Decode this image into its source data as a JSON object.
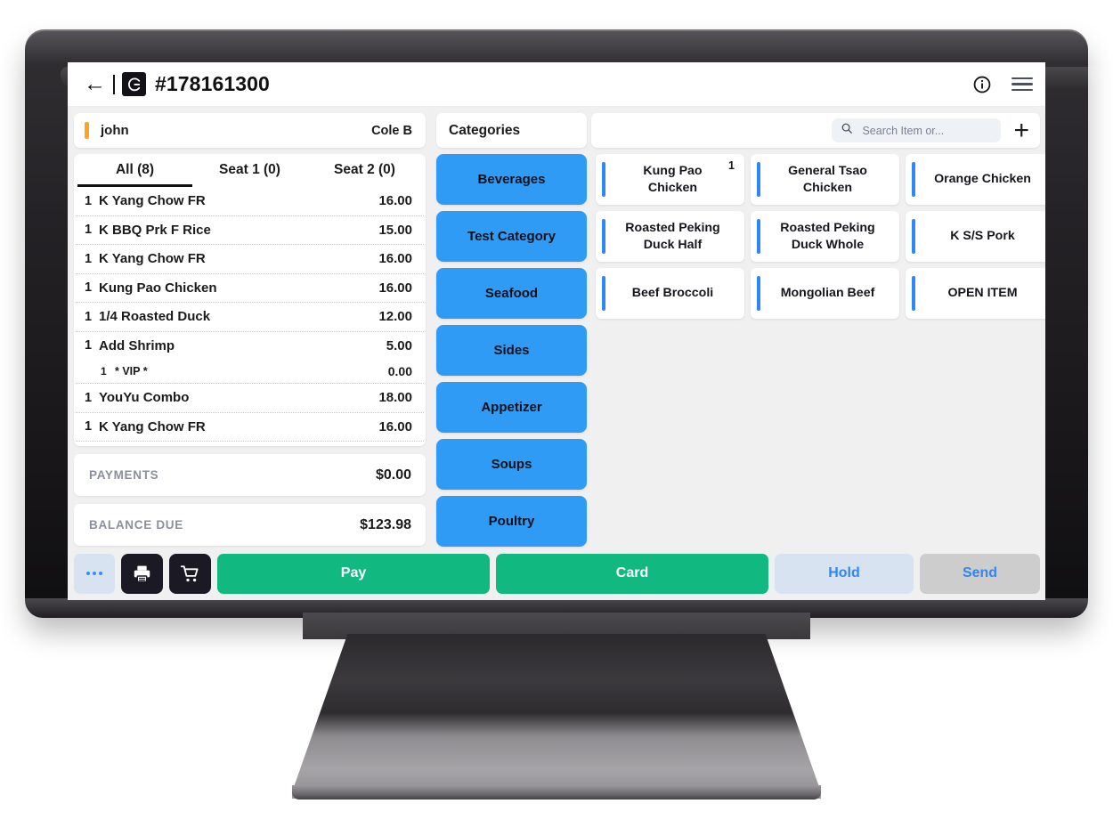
{
  "appbar": {
    "back_icon": "back-arrow-icon",
    "logo_icon": "brand-logo-icon",
    "order_number": "#178161300",
    "info_icon": "info-circle-icon",
    "menu_icon": "hamburger-menu-icon"
  },
  "customer": {
    "name": "john",
    "server": "Cole B",
    "accent_color": "#ffa51f"
  },
  "seat_tabs": [
    {
      "label": "All (8)",
      "active": true
    },
    {
      "label": "Seat 1 (0)",
      "active": false
    },
    {
      "label": "Seat 2 (0)",
      "active": false
    }
  ],
  "order_items": [
    {
      "qty": "1",
      "name": "K Yang Chow FR",
      "price": "16.00",
      "modifier": false
    },
    {
      "qty": "1",
      "name": "K BBQ Prk F Rice",
      "price": "15.00",
      "modifier": false
    },
    {
      "qty": "1",
      "name": "K Yang Chow FR",
      "price": "16.00",
      "modifier": false
    },
    {
      "qty": "1",
      "name": "Kung Pao Chicken",
      "price": "16.00",
      "modifier": false
    },
    {
      "qty": "1",
      "name": "1/4 Roasted Duck",
      "price": "12.00",
      "modifier": false
    },
    {
      "qty": "1",
      "name": "Add Shrimp",
      "price": "5.00",
      "modifier": false,
      "no_border": true
    },
    {
      "qty": "1",
      "name": "* VIP *",
      "price": "0.00",
      "modifier": true
    },
    {
      "qty": "1",
      "name": "YouYu Combo",
      "price": "18.00",
      "modifier": false
    },
    {
      "qty": "1",
      "name": "K Yang Chow FR",
      "price": "16.00",
      "modifier": false
    }
  ],
  "totals": {
    "payments_label": "PAYMENTS",
    "payments_value": "$0.00",
    "balance_label": "BALANCE DUE",
    "balance_value": "$123.98"
  },
  "categories": {
    "header": "Categories",
    "accent_color": "#2f9bf5",
    "items": [
      {
        "label": "Beverages"
      },
      {
        "label": "Test Category"
      },
      {
        "label": "Seafood"
      },
      {
        "label": "Sides"
      },
      {
        "label": "Appetizer"
      },
      {
        "label": "Soups"
      },
      {
        "label": "Poultry"
      }
    ]
  },
  "search": {
    "icon": "search-icon",
    "placeholder": "Search Item or...",
    "value": "",
    "add_icon": "plus-icon"
  },
  "menu_items": [
    {
      "label": "Kung Pao\nChicken",
      "badge": "1"
    },
    {
      "label": "General Tsao\nChicken",
      "badge": ""
    },
    {
      "label": "Orange Chicken",
      "badge": ""
    },
    {
      "label": "Roasted Peking\nDuck Half",
      "badge": ""
    },
    {
      "label": "Roasted Peking\nDuck Whole",
      "badge": ""
    },
    {
      "label": "K S/S Pork",
      "badge": ""
    },
    {
      "label": "Beef Broccoli",
      "badge": ""
    },
    {
      "label": "Mongolian Beef",
      "badge": ""
    },
    {
      "label": "OPEN ITEM",
      "badge": ""
    }
  ],
  "actionbar": {
    "more_icon": "ellipsis-icon",
    "print_icon": "printer-icon",
    "cart_icon": "shopping-cart-icon",
    "pay_label": "Pay",
    "card_label": "Card",
    "hold_label": "Hold",
    "send_label": "Send",
    "pay_color": "#11b981",
    "hold_color": "#d8e3f2",
    "send_color": "#cdcdcd"
  }
}
